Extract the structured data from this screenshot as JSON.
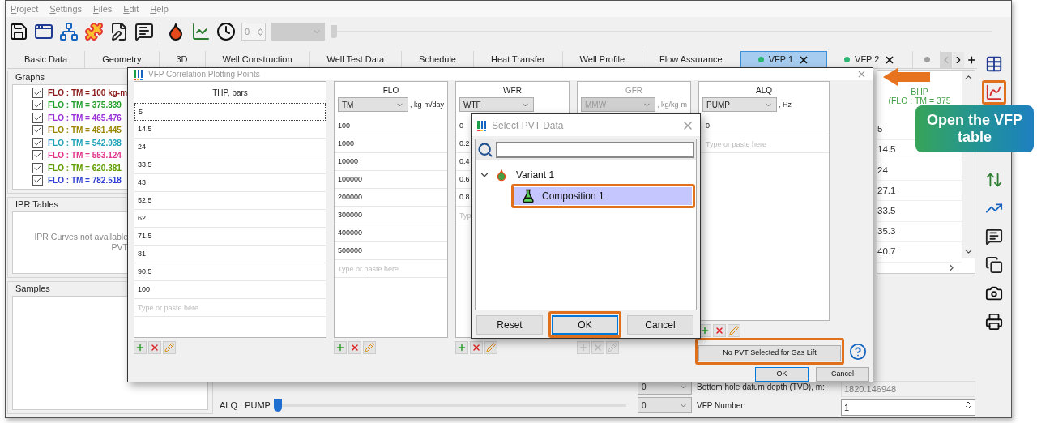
{
  "menu": [
    "Project",
    "Settings",
    "Files",
    "Edit",
    "Help"
  ],
  "toolbar": {
    "spin": "0",
    "slider": {
      "level": 0
    }
  },
  "tabs": [
    {
      "label": "Basic Data",
      "selected": false
    },
    {
      "label": "Geometry",
      "selected": false
    },
    {
      "label": "3D",
      "selected": false
    },
    {
      "label": "Well Construction",
      "selected": false
    },
    {
      "label": "Well Test Data",
      "selected": false
    },
    {
      "label": "Schedule",
      "selected": false
    },
    {
      "label": "Heat Transfer",
      "selected": false
    },
    {
      "label": "Well Profile",
      "selected": false
    },
    {
      "label": "Flow Assurance",
      "selected": false
    },
    {
      "label": "VFP 1",
      "selected": true,
      "closable": true,
      "color": "#2bb673"
    },
    {
      "label": "VFP 2",
      "selected": false,
      "closable": true,
      "color": "#2bb673"
    },
    {
      "selected": false,
      "color": "#9e9e9e"
    }
  ],
  "graphs": {
    "title": "Graphs",
    "items": [
      {
        "label": "FLO : TM = 100 kg-m",
        "checked": true,
        "color": "#8b1a1a"
      },
      {
        "label": "FLO : TM = 375.839",
        "checked": true,
        "color": "#23a02c"
      },
      {
        "label": "FLO : TM = 465.476",
        "checked": true,
        "color": "#9b30d9"
      },
      {
        "label": "FLO : TM = 481.445",
        "checked": true,
        "color": "#9c8600"
      },
      {
        "label": "FLO : TM = 542.938",
        "checked": true,
        "color": "#1fa3b8"
      },
      {
        "label": "FLO : TM = 553.124",
        "checked": true,
        "color": "#e0338a"
      },
      {
        "label": "FLO : TM = 620.381",
        "checked": true,
        "color": "#5f9e00"
      },
      {
        "label": "FLO : TM = 782.518",
        "checked": true,
        "color": "#2f3fd0"
      }
    ]
  },
  "ipr_tables": {
    "title": "IPR Tables",
    "message_lines": [
      "IPR Curves not available",
      "PVT"
    ]
  },
  "samples": {
    "title": "Samples"
  },
  "results": {
    "header": [
      "BHP",
      "(FLO : TM = 375"
    ],
    "values": [
      "5",
      "14.5",
      "24",
      "27.1",
      "33.5",
      "35.3",
      "40.7"
    ]
  },
  "bottom_rows": [
    {
      "combo": "0",
      "label": "Bottom hole datum depth (TVD), m:",
      "value": "1820.146948",
      "disabled": true,
      "kind": "text"
    },
    {
      "slider_label": "ALQ : PUMP",
      "level": 0,
      "combo": "0",
      "label": "VFP Number:",
      "value": "1",
      "disabled": false,
      "kind": "spin"
    }
  ],
  "right_toolbar": {
    "top": [
      {
        "kind": "table",
        "highlighted": false
      },
      {
        "kind": "chart",
        "highlighted": true
      }
    ],
    "bottom": [
      {
        "kind": "swap",
        "highlighted": false
      },
      {
        "kind": "trend",
        "highlighted": false
      },
      {
        "kind": "bubble",
        "highlighted": false
      },
      {
        "kind": "copy",
        "highlighted": false
      },
      {
        "kind": "camera",
        "highlighted": false
      },
      {
        "kind": "printer",
        "highlighted": false
      }
    ]
  },
  "callout": {
    "text": "Open the VFP table"
  },
  "vfp_dialog": {
    "title": "VFP Correlation Plotting Points",
    "columns": [
      {
        "header": "THP, bars",
        "disabled": false,
        "values": [
          {
            "text": "5",
            "focused": true
          },
          {
            "text": "14.5"
          },
          {
            "text": "24"
          },
          {
            "text": "33.5"
          },
          {
            "text": "43"
          },
          {
            "text": "52.5"
          },
          {
            "text": "62"
          },
          {
            "text": "71.5"
          },
          {
            "text": "81"
          },
          {
            "text": "90.5"
          },
          {
            "text": "100"
          }
        ],
        "placeholder": "Type or paste here"
      },
      {
        "header": "FLO",
        "combo": "TM",
        "unit": ", kg-m/day",
        "disabled": false,
        "values": [
          "100",
          "1000",
          "10000",
          "100000",
          "200000",
          "300000",
          "400000",
          "500000"
        ],
        "placeholder": "Type or paste here"
      },
      {
        "header": "WFR",
        "combo": "WTF",
        "disabled": false,
        "values": [
          "0",
          "0.2",
          "0.4",
          "0.6",
          "0.8"
        ],
        "placeholder": "Typ"
      },
      {
        "header": "GFR",
        "combo": "MMW",
        "unit": ", kg/kg-m",
        "disabled": true
      },
      {
        "header": "ALQ",
        "combo": "PUMP",
        "unit": ", Hz",
        "disabled": false,
        "values": [
          "0"
        ],
        "placeholder": "Type or paste here"
      }
    ],
    "gas_lift_button": {
      "label": "No PVT Selected for Gas Lift",
      "highlighted": true
    },
    "buttons": [
      {
        "label": "OK",
        "default": true
      },
      {
        "label": "Cancel",
        "default": false
      }
    ]
  },
  "pvt_dialog": {
    "title": "Select PVT Data",
    "tree": [
      {
        "label": "Variant 1",
        "expanded": true,
        "selected": false,
        "highlighted": false,
        "children": [
          {
            "label": "Composition 1",
            "selected": true,
            "highlighted": true
          }
        ]
      }
    ],
    "buttons": [
      {
        "label": "Reset",
        "default": false,
        "highlighted": false
      },
      {
        "label": "OK",
        "default": true,
        "highlighted": true
      },
      {
        "label": "Cancel",
        "default": false,
        "highlighted": false
      }
    ]
  }
}
